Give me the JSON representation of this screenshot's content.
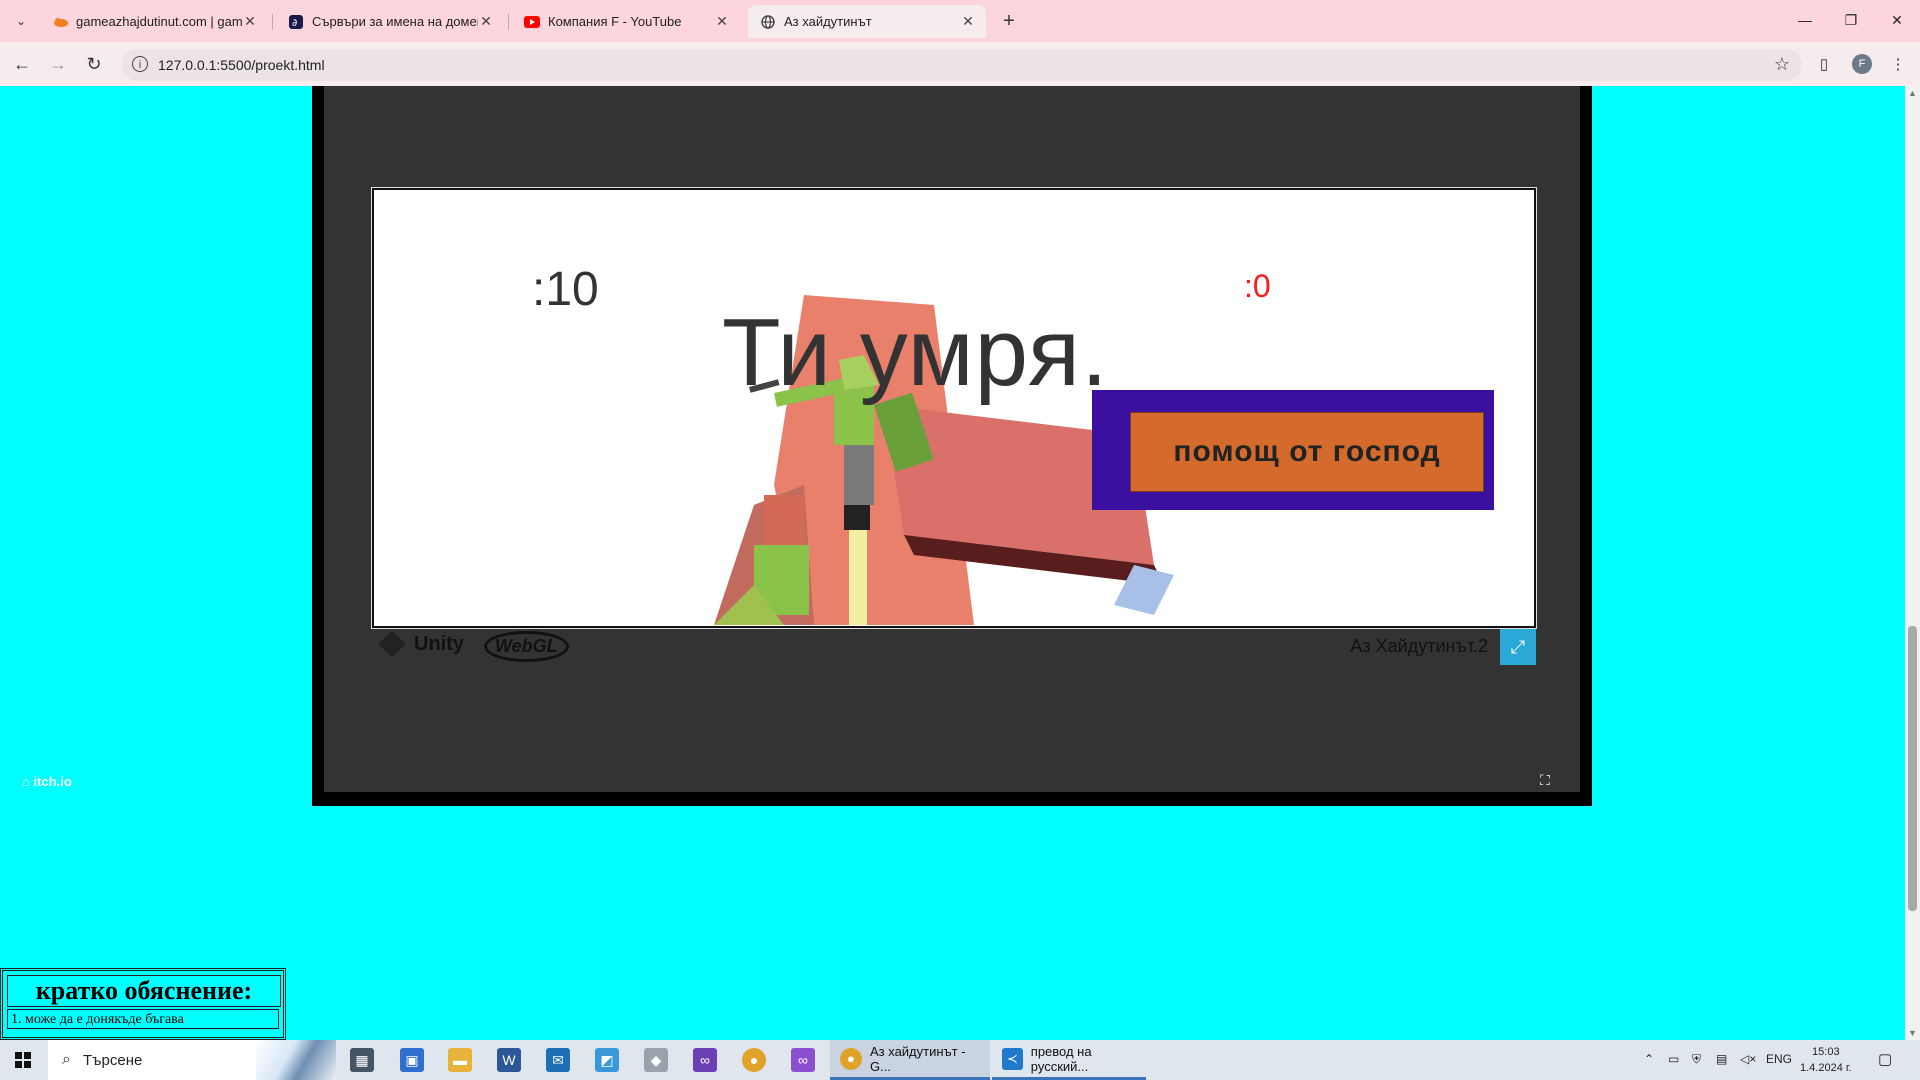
{
  "browser": {
    "tabs": [
      {
        "title": "gameazhajdutinut.com | gamea",
        "favicon": "cloud-icon",
        "active": false
      },
      {
        "title": "Сървъри за имена на домейн",
        "favicon": "link-icon",
        "active": false
      },
      {
        "title": "Компания F - YouTube",
        "favicon": "youtube-icon",
        "active": false
      },
      {
        "title": "Аз хайдутинът",
        "favicon": "globe-icon",
        "active": true
      }
    ],
    "url": "127.0.0.1:5500/proekt.html",
    "profile_initial": "F"
  },
  "game": {
    "score_left": ":10",
    "score_right": ":0",
    "death_message": "Ти умря.",
    "help_button_label": "помощ от господ",
    "unity_label": "Unity",
    "webgl_label": "WebGL",
    "title": "Аз Хайдутинът.2",
    "host_label": "itch.io"
  },
  "explanation": {
    "title": "кратко обяснение:",
    "items": [
      "1. може да е донякъде бъгава"
    ]
  },
  "taskbar": {
    "search_placeholder": "Търсене",
    "apps": [
      {
        "title": "Аз хайдутинът - G...",
        "icon": "chrome-icon",
        "active": true
      },
      {
        "title": "превод на русский...",
        "icon": "vscode-icon",
        "active": false
      }
    ],
    "language": "ENG",
    "time": "15:03",
    "date": "1.4.2024 г."
  },
  "colors": {
    "page_background": "#00ffff",
    "death_text": "#333333",
    "score_right": "#ff1a1a",
    "help_panel": "#3b0fa0",
    "help_button": "#d46b2c",
    "fullscreen_button": "#2aa9d6"
  }
}
